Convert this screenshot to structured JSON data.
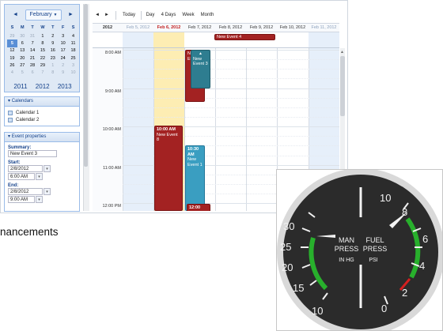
{
  "calendar": {
    "month_label": "February",
    "weekday_headers": [
      "S",
      "M",
      "T",
      "W",
      "T",
      "F",
      "S"
    ],
    "weeks": [
      [
        "29",
        "30",
        "31",
        "1",
        "2",
        "3",
        "4"
      ],
      [
        "5",
        "6",
        "7",
        "8",
        "9",
        "10",
        "11"
      ],
      [
        "12",
        "13",
        "14",
        "15",
        "16",
        "17",
        "18"
      ],
      [
        "19",
        "20",
        "21",
        "22",
        "23",
        "24",
        "25"
      ],
      [
        "26",
        "27",
        "28",
        "29",
        "1",
        "2",
        "3"
      ],
      [
        "4",
        "5",
        "6",
        "7",
        "8",
        "9",
        "10"
      ]
    ],
    "years": [
      "2011",
      "2012",
      "2013"
    ],
    "calendars_header": "Calendars",
    "calendar_items": [
      "Calendar 1",
      "Calendar 2"
    ],
    "event_props_header": "Event properties",
    "summary_label": "Summary:",
    "summary_value": "New Event 3",
    "start_label": "Start:",
    "start_date": "2/8/2012",
    "start_time": "6:00 AM",
    "end_label": "End:",
    "end_date": "2/8/2012",
    "end_time": "9:00 AM"
  },
  "toolbar": {
    "prev": "◄",
    "next": "►",
    "today": "Today",
    "day": "Day",
    "four_days": "4 Days",
    "week": "Week",
    "month": "Month"
  },
  "week_view": {
    "year_label": "2012",
    "days": [
      "Feb 5, 2012",
      "Feb 6, 2012",
      "Feb 7, 2012",
      "Feb 8, 2012",
      "Feb 9, 2012",
      "Feb 10, 2012",
      "Feb 11, 2012"
    ],
    "allday_event": "New Event 4",
    "times": [
      "8:00 AM",
      "9:00 AM",
      "10:00 AM",
      "11:00 AM",
      "12:00 PM"
    ],
    "events": {
      "ev_a": "Ne",
      "ev_a2": "Ev",
      "ev_b": "New",
      "ev_b2": "Event 3",
      "ev_c_time": "10:00 AM",
      "ev_c_title": "New Event 8",
      "ev_d_time": "10:30",
      "ev_d_time2": "AM",
      "ev_d_title": "New",
      "ev_d_title2": "Event 1",
      "ev_e_time": "12:00"
    }
  },
  "caption_text": "nancements",
  "gauge": {
    "label_line1_left": "MAN",
    "label_line1_right": "FUEL",
    "label_line2_left": "PRESS",
    "label_line2_right": "PRESS",
    "label_line3_left": "IN HG",
    "label_line3_right": "PSI",
    "left_scale": [
      "10",
      "15",
      "20",
      "25",
      "30"
    ],
    "right_scale": [
      "10",
      "8",
      "6",
      "4",
      "2",
      "0"
    ],
    "colors": {
      "green": "#28b02c",
      "red": "#d42020",
      "face": "#2b2b2b"
    }
  },
  "colors": {
    "today_highlight": "#fdedb3",
    "weekend_bg": "#e6effa",
    "event_red": "#a32222",
    "event_teal": "#3a9ec1",
    "panel_border": "#99bbe8"
  }
}
